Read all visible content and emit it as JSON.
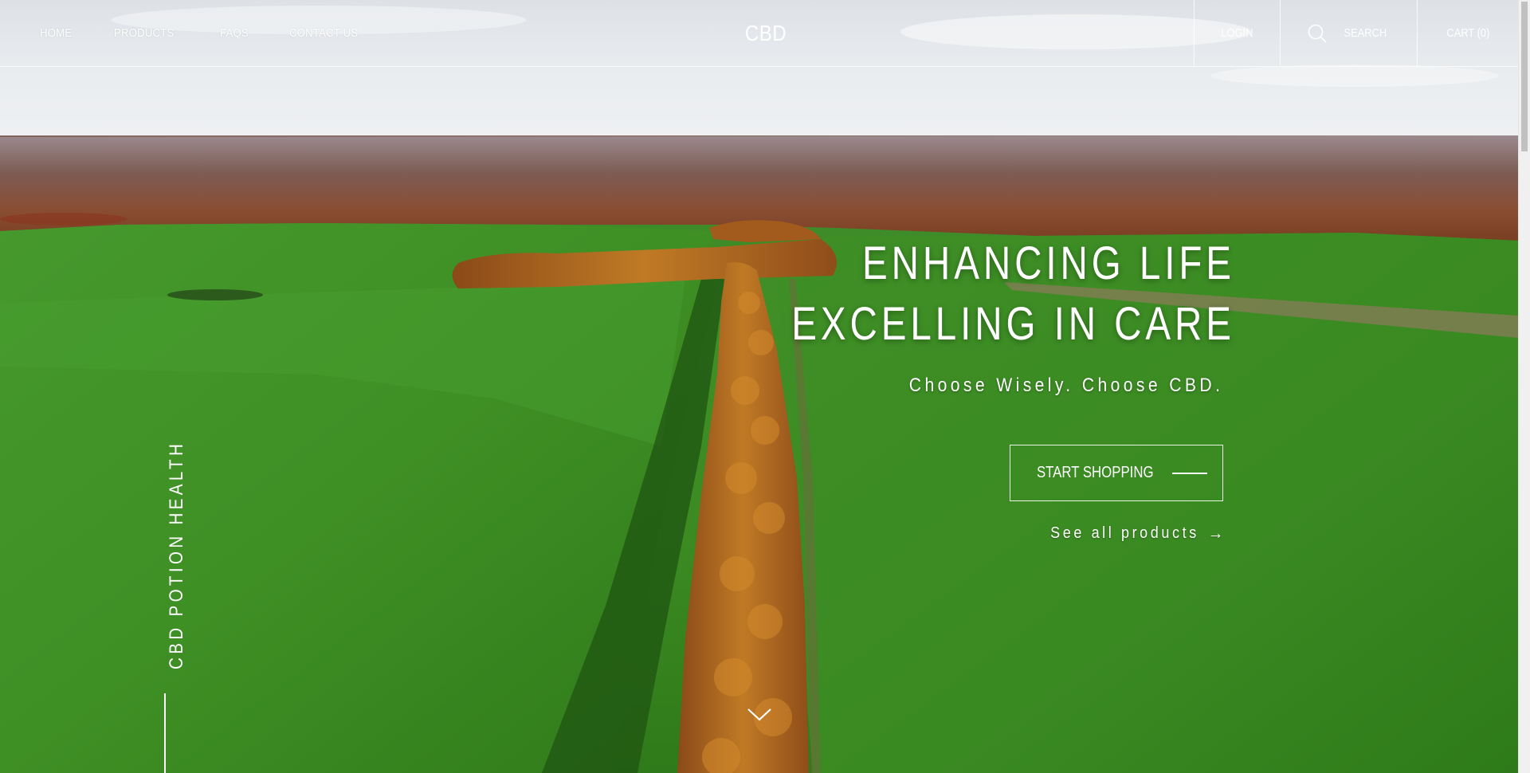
{
  "nav": {
    "items": [
      {
        "label": "HOME"
      },
      {
        "label": "PRODUCTS"
      },
      {
        "label": "FAQS"
      },
      {
        "label": "CONTACT US"
      }
    ],
    "brand": "CBD",
    "login": "LOGIN",
    "search": "SEARCH",
    "cart": "CART (0)",
    "search_icon": "search-icon"
  },
  "hero": {
    "headline_line1": "ENHANCING LIFE",
    "headline_line2": "EXCELLING IN CARE",
    "tagline": "Choose Wisely. Choose CBD.",
    "cta_label": "START SHOPPING",
    "see_all": "See all products",
    "see_all_arrow": "→",
    "side_label": "CBD POTION HEALTH",
    "scroll_icon": "chevron-down-icon"
  },
  "colors": {
    "text": "#ffffff",
    "field_green": "#3f8f26",
    "autumn_trees": "#b0631f",
    "sky": "#e8ebee"
  }
}
